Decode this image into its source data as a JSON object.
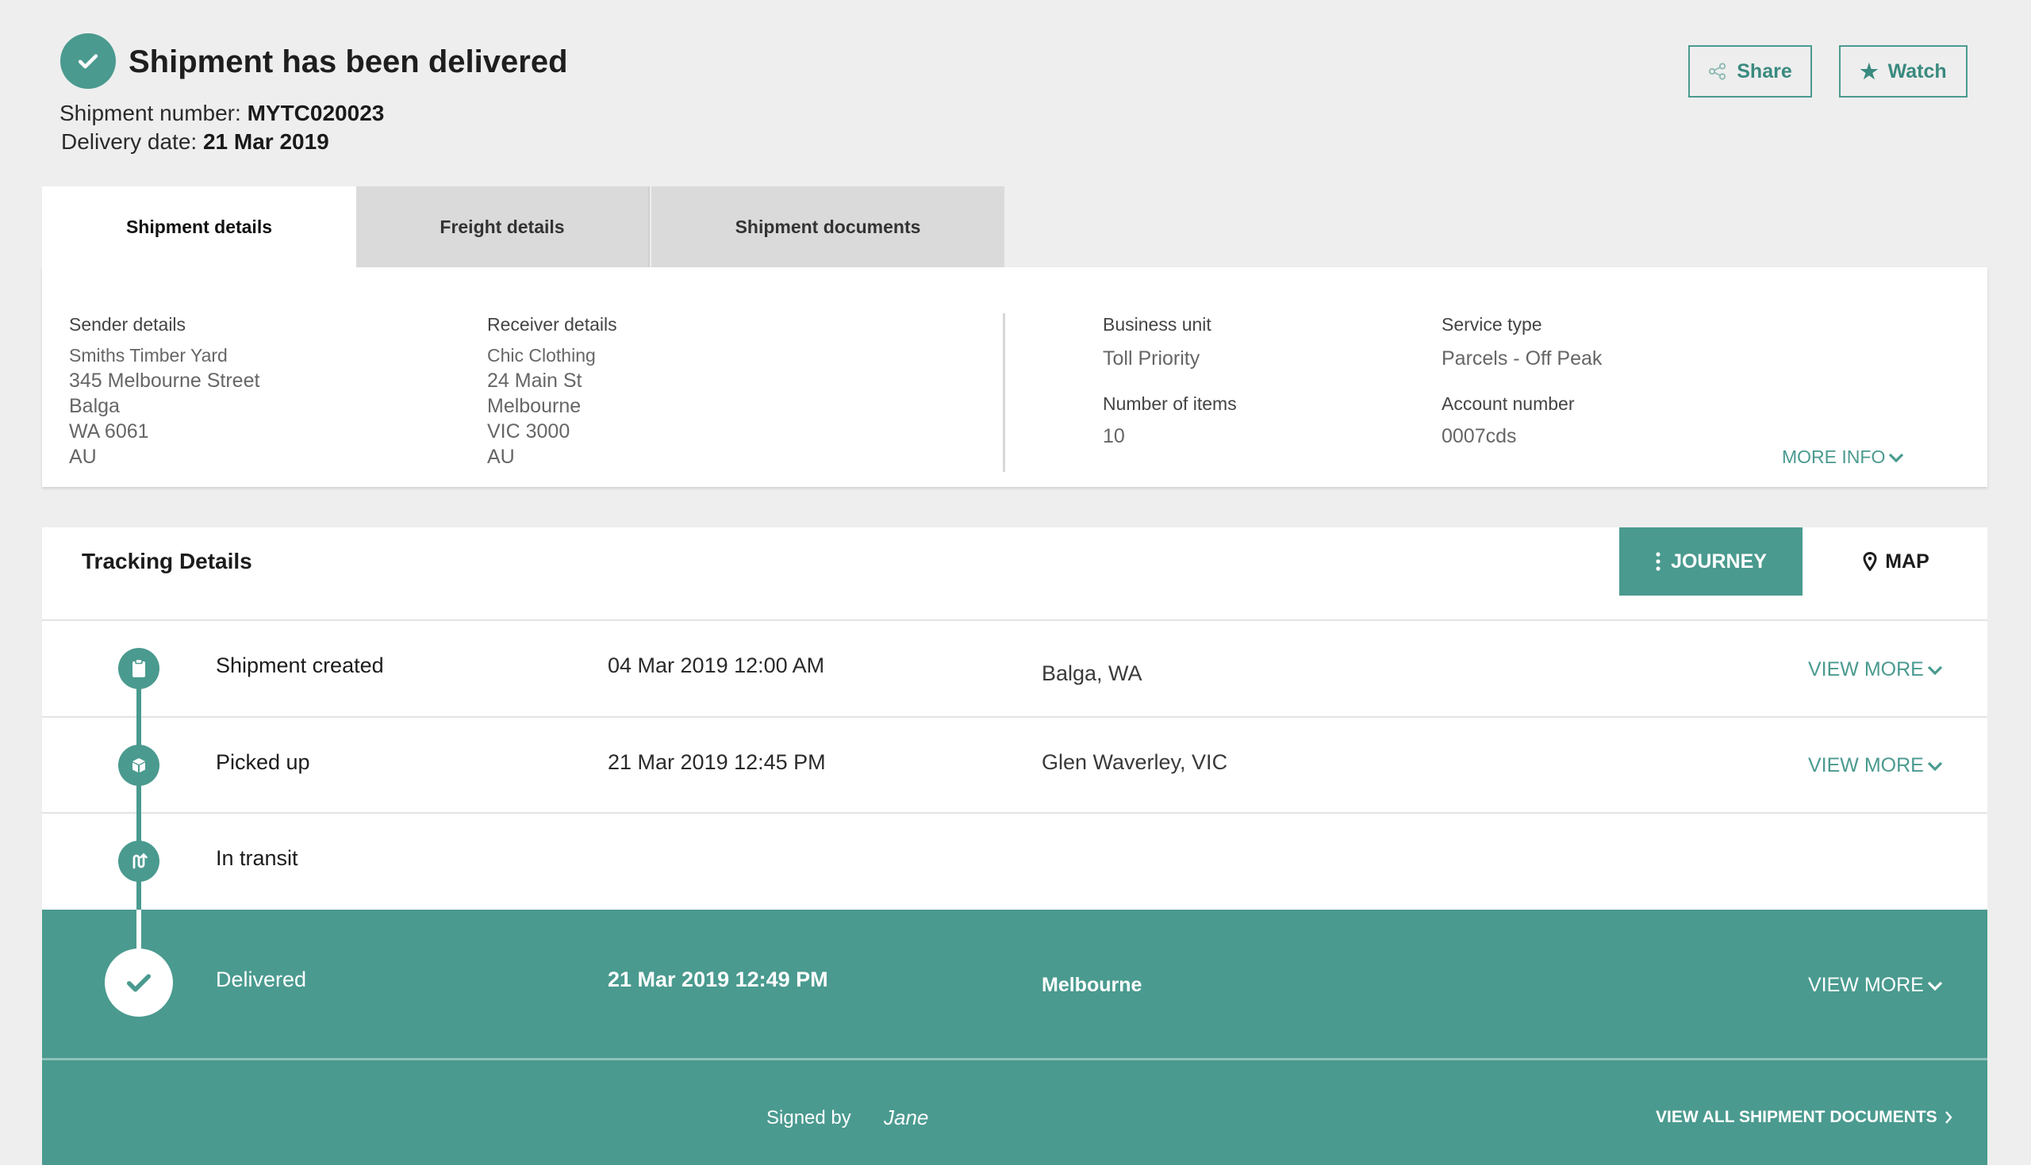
{
  "header": {
    "title": "Shipment has been delivered",
    "shipment_number_label": "Shipment number:",
    "shipment_number": "MYTC020023",
    "delivery_date_label": "Delivery date:",
    "delivery_date": "21 Mar 2019",
    "share_label": "Share",
    "watch_label": "Watch"
  },
  "tabs": [
    {
      "label": "Shipment details",
      "active": true
    },
    {
      "label": "Freight details",
      "active": false
    },
    {
      "label": "Shipment documents",
      "active": false
    }
  ],
  "details": {
    "sender": {
      "label": "Sender details",
      "name": "Smiths Timber Yard",
      "street": "345 Melbourne Street",
      "suburb": "Balga",
      "state_postcode": "WA 6061",
      "country": "AU"
    },
    "receiver": {
      "label": "Receiver details",
      "name": "Chic Clothing",
      "street": "24 Main St",
      "suburb": "Melbourne",
      "state_postcode": "VIC 3000",
      "country": "AU"
    },
    "business_unit_label": "Business unit",
    "business_unit": "Toll Priority",
    "service_type_label": "Service type",
    "service_type": "Parcels - Off Peak",
    "items_label": "Number of items",
    "items": "10",
    "account_label": "Account number",
    "account": "0007cds",
    "more_info": "MORE INFO"
  },
  "tracking": {
    "title": "Tracking Details",
    "journey_label": "JOURNEY",
    "map_label": "MAP",
    "view_more": "VIEW MORE",
    "events": [
      {
        "name": "Shipment created",
        "datetime": "04 Mar 2019 12:00 AM",
        "location": "Balga, WA"
      },
      {
        "name": "Picked up",
        "datetime": "21 Mar 2019 12:45 PM",
        "location": "Glen Waverley, VIC"
      },
      {
        "name": "In transit",
        "datetime": "",
        "location": ""
      },
      {
        "name": "Delivered",
        "datetime": "21 Mar 2019 12:49 PM",
        "location": "Melbourne"
      }
    ],
    "signed_by_label": "Signed by",
    "signed_by": "Jane",
    "view_all_docs": "VIEW ALL SHIPMENT DOCUMENTS"
  },
  "colors": {
    "accent": "#4a9a8f",
    "background": "#eeeeee",
    "tab_inactive": "#dadada"
  }
}
